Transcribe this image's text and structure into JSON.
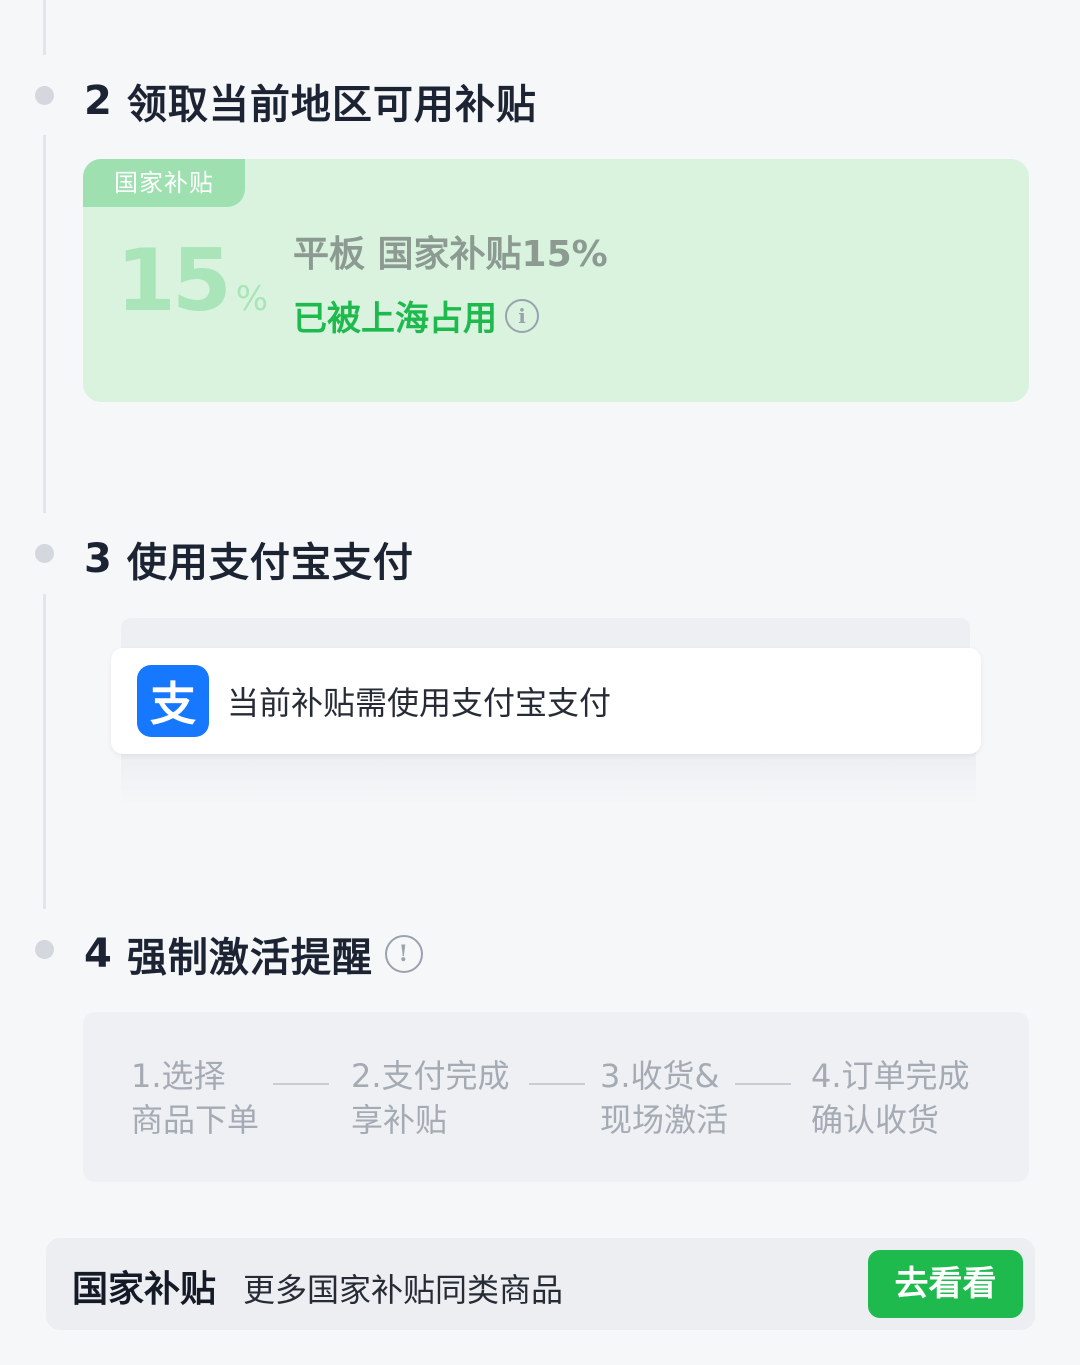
{
  "steps": {
    "step2": {
      "number": "2",
      "title": "领取当前地区可用补贴"
    },
    "step3": {
      "number": "3",
      "title": "使用支付宝支付"
    },
    "step4": {
      "number": "4",
      "title": "强制激活提醒"
    }
  },
  "subsidy_card": {
    "tag": "国家补贴",
    "percent_value": "15",
    "percent_symbol": "%",
    "name": "平板 国家补贴15%",
    "status": "已被上海占用",
    "info_glyph": "i"
  },
  "alipay": {
    "logo_glyph": "支",
    "text": "当前补贴需使用支付宝支付"
  },
  "activation_flow": {
    "warning_glyph": "!",
    "items": [
      {
        "line1": "1.选择",
        "line2": "商品下单"
      },
      {
        "line1": "2.支付完成",
        "line2": "享补贴"
      },
      {
        "line1": "3.收货&",
        "line2": "现场激活"
      },
      {
        "line1": "4.订单完成",
        "line2": "确认收货"
      }
    ]
  },
  "bottom_bar": {
    "brand": "国家补贴",
    "description": "更多国家补贴同类商品",
    "button_label": "去看看"
  },
  "colors": {
    "accent_green": "#1fba4e",
    "card_green_bg": "#d9f3df",
    "alipay_blue": "#1677ff"
  },
  "icons": [
    "info-icon",
    "alipay-logo-icon",
    "warning-icon"
  ]
}
